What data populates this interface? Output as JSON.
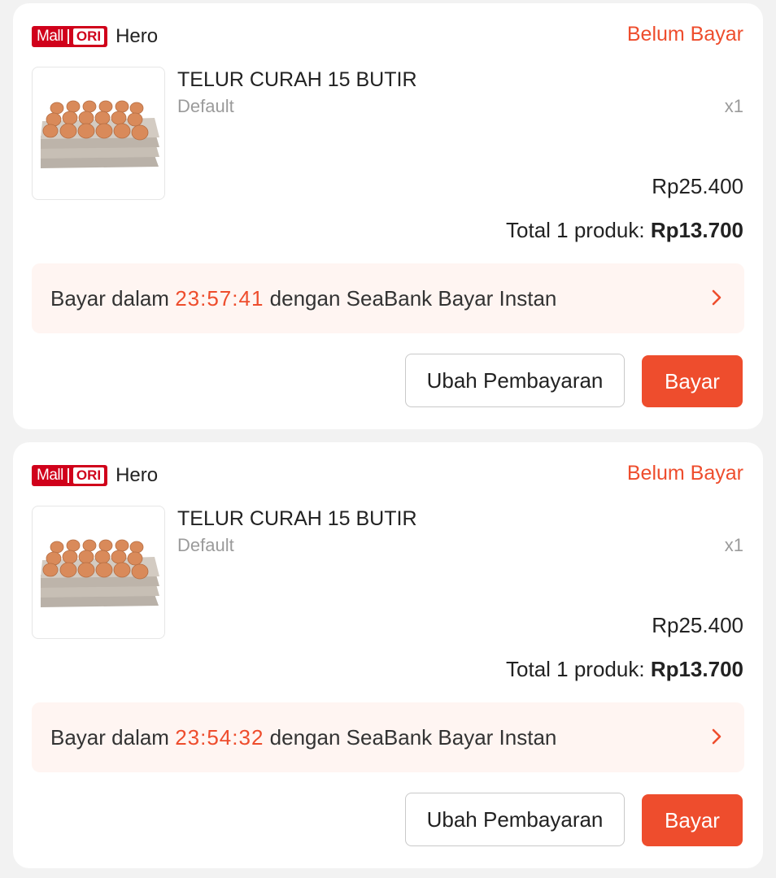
{
  "orders": [
    {
      "badge": {
        "mall": "Mall",
        "ori": "ORI"
      },
      "shop_name": "Hero",
      "status": "Belum Bayar",
      "product_name": "TELUR CURAH 15 BUTIR",
      "variant": "Default",
      "quantity": "x1",
      "price": "Rp25.400",
      "total_label": "Total 1 produk:",
      "total_amount": "Rp13.700",
      "pay_prefix": "Bayar dalam",
      "countdown": "23:57:41",
      "pay_suffix": "dengan SeaBank Bayar Instan",
      "change_payment_label": "Ubah Pembayaran",
      "pay_label": "Bayar"
    },
    {
      "badge": {
        "mall": "Mall",
        "ori": "ORI"
      },
      "shop_name": "Hero",
      "status": "Belum Bayar",
      "product_name": "TELUR CURAH 15 BUTIR",
      "variant": "Default",
      "quantity": "x1",
      "price": "Rp25.400",
      "total_label": "Total 1 produk:",
      "total_amount": "Rp13.700",
      "pay_prefix": "Bayar dalam",
      "countdown": "23:54:32",
      "pay_suffix": "dengan SeaBank Bayar Instan",
      "change_payment_label": "Ubah Pembayaran",
      "pay_label": "Bayar"
    }
  ],
  "colors": {
    "accent": "#ee4d2d",
    "mall_badge": "#d0011b",
    "banner_bg": "#fff5f2"
  },
  "icons": {
    "product_image": "egg-tray-image",
    "chevron": "chevron-right-icon"
  }
}
